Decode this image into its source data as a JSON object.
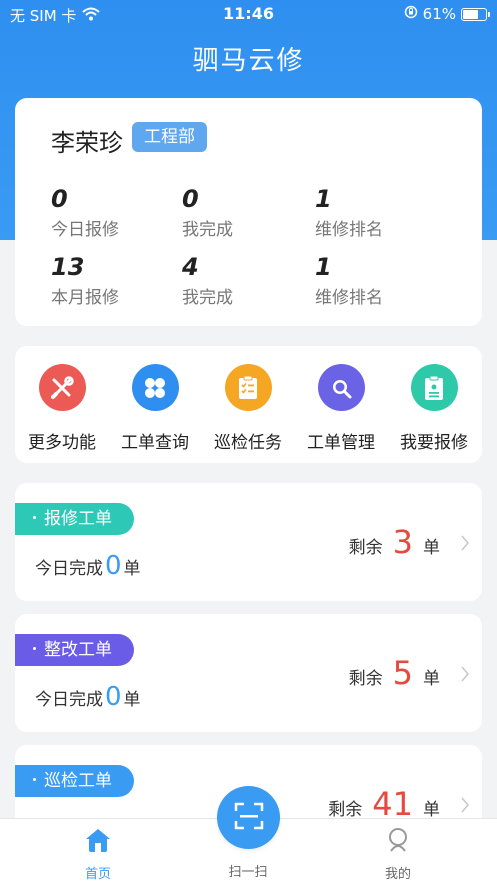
{
  "status_bar": {
    "carrier": "无 SIM 卡",
    "time": "11:46",
    "battery": "61%",
    "battery_level": 0.61
  },
  "header": {
    "title": "驷马云修"
  },
  "user": {
    "name": "李荣珍",
    "department": "工程部",
    "stats": [
      {
        "value": "0",
        "label": "今日报修"
      },
      {
        "value": "0",
        "label": "我完成"
      },
      {
        "value": "1",
        "label": "维修排名"
      },
      {
        "value": "13",
        "label": "本月报修"
      },
      {
        "value": "4",
        "label": "我完成"
      },
      {
        "value": "1",
        "label": "维修排名"
      }
    ]
  },
  "functions": [
    {
      "label": "更多功能",
      "icon": "wrench-screwdriver-icon",
      "color": "#ec5a56"
    },
    {
      "label": "工单查询",
      "icon": "grid-petals-icon",
      "color": "#2f8ff0"
    },
    {
      "label": "巡检任务",
      "icon": "checklist-icon",
      "color": "#f5a623"
    },
    {
      "label": "工单管理",
      "icon": "search-icon",
      "color": "#6b63e6"
    },
    {
      "label": "我要报修",
      "icon": "clipboard-icon",
      "color": "#2ec9a8"
    }
  ],
  "orders": [
    {
      "tag": "报修工单",
      "tag_color": "#2ec9b6",
      "today_prefix": "今日完成",
      "today_value": "0",
      "today_suffix": "单",
      "remain_prefix": "剩余",
      "remain_value": "3",
      "remain_suffix": "单"
    },
    {
      "tag": "整改工单",
      "tag_color": "#6b5ce7",
      "today_prefix": "今日完成",
      "today_value": "0",
      "today_suffix": "单",
      "remain_prefix": "剩余",
      "remain_value": "5",
      "remain_suffix": "单"
    },
    {
      "tag": "巡检工单",
      "tag_color": "#3a9bf3",
      "remain_prefix": "剩余",
      "remain_value": "41",
      "remain_suffix": "单"
    }
  ],
  "tabbar": {
    "home": "首页",
    "scan": "扫一扫",
    "mine": "我的",
    "active_color": "#3a9bf3"
  }
}
